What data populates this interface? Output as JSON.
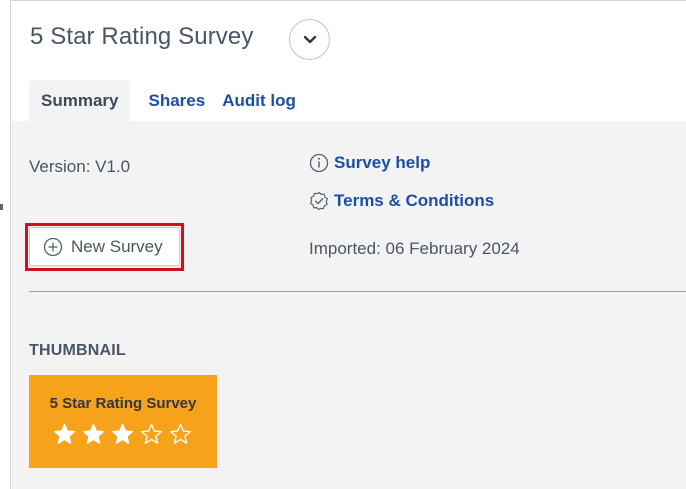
{
  "header": {
    "title": "5 Star Rating Survey"
  },
  "tabs": [
    {
      "label": "Summary",
      "active": true
    },
    {
      "label": "Shares",
      "active": false
    },
    {
      "label": "Audit log",
      "active": false
    }
  ],
  "summary": {
    "version": "Version: V1.0",
    "survey_help": "Survey help",
    "terms": "Terms & Conditions",
    "new_survey_label": "New Survey",
    "imported": "Imported: 06 February 2024"
  },
  "thumbnail": {
    "heading": "THUMBNAIL",
    "title": "5 Star Rating Survey",
    "rating_filled": 3,
    "rating_max": 5,
    "background_color": "#f7a21b"
  },
  "colors": {
    "link": "#1b4fa6",
    "highlight": "#d0111b",
    "panel": "#f3f3f3"
  },
  "icons": [
    "chevron-down-icon",
    "info-icon",
    "badge-check-icon",
    "plus-circle-icon",
    "star-icon"
  ]
}
